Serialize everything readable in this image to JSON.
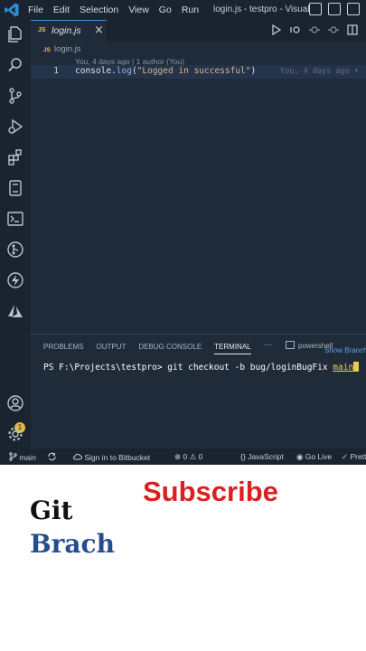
{
  "titlebar": {
    "menu": [
      "File",
      "Edit",
      "Selection",
      "View",
      "Go",
      "Run"
    ],
    "window_title": "login.js - testpro - Visual ..."
  },
  "tab": {
    "icon_label": "JS",
    "filename": "login.js",
    "close_glyph": "×"
  },
  "breadcrumb": {
    "icon_label": "JS",
    "file": "login.js"
  },
  "editor": {
    "codelens": "You, 4 days ago | 1 author (You)",
    "line_number": "1",
    "code": {
      "object": "console.",
      "method": "log",
      "open": "(",
      "string": "\"Logged in successful\"",
      "close": ")"
    },
    "blame": "You, 4 days ago •"
  },
  "panel": {
    "tabs": [
      "PROBLEMS",
      "OUTPUT",
      "DEBUG CONSOLE",
      "TERMINAL"
    ],
    "more": "···",
    "shell": "powershell",
    "tooltip": "Show Branch",
    "prompt": "PS F:\\Projects\\testpro> git checkout -b bug/loginBugFix ",
    "branch": "main"
  },
  "status_bar": {
    "branch": "main",
    "bitbucket": "Sign in to Bitbucket",
    "errors": "0",
    "warnings": "0",
    "language": "JavaScript",
    "golive": "Go Live",
    "prettier": "Prettier"
  },
  "accounts_badge": "1",
  "promo": {
    "line1": "Git",
    "line2": "Brach",
    "cta": "Subscribe"
  },
  "colors": {
    "editor_bg": "#1f2b38",
    "accent": "#3a8de0",
    "git_brach": "#274b8f",
    "subscribe": "#d9211f",
    "js_icon": "#e8c84a"
  }
}
